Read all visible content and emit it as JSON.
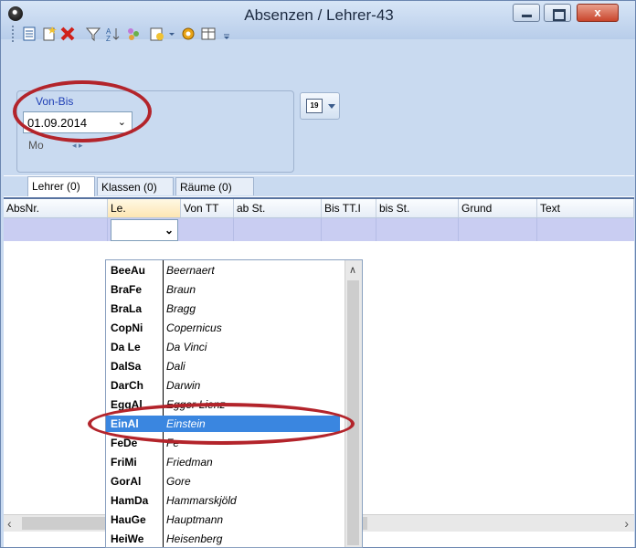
{
  "window": {
    "title": "Absenzen / Lehrer-43",
    "close_label": "x"
  },
  "toolbar": {
    "icons": [
      "list-icon",
      "new-icon",
      "delete-icon",
      "filter-icon",
      "sort-icon",
      "people-icon",
      "report-icon",
      "settings-icon",
      "calendar-grid-icon"
    ]
  },
  "range": {
    "group_label": "Von-Bis",
    "date_value": "01.09.2014",
    "weekday": "Mo",
    "nav": "◂ ▸"
  },
  "tabs": [
    {
      "label": "Lehrer (0)"
    },
    {
      "label": "Klassen (0)"
    },
    {
      "label": "Räume (0)"
    }
  ],
  "grid": {
    "columns": [
      "AbsNr.",
      "Le.",
      "Von TT",
      "ab St.",
      "Bis TT.I",
      "bis St.",
      "Grund",
      "Text"
    ]
  },
  "dropdown": {
    "items": [
      {
        "code": "BeeAu",
        "name": "Beernaert"
      },
      {
        "code": "BraFe",
        "name": "Braun"
      },
      {
        "code": "BraLa",
        "name": "Bragg"
      },
      {
        "code": "CopNi",
        "name": "Copernicus"
      },
      {
        "code": "Da Le",
        "name": "Da Vinci"
      },
      {
        "code": "DalSa",
        "name": "Dali"
      },
      {
        "code": "DarCh",
        "name": "Darwin"
      },
      {
        "code": "EggAl",
        "name": "Egger-Lienz"
      },
      {
        "code": "EinAl",
        "name": "Einstein"
      },
      {
        "code": "FeDe",
        "name": "Fe"
      },
      {
        "code": "FriMi",
        "name": "Friedman"
      },
      {
        "code": "GorAl",
        "name": "Gore"
      },
      {
        "code": "HamDa",
        "name": "Hammarskjöld"
      },
      {
        "code": "HauGe",
        "name": "Hauptmann"
      },
      {
        "code": "HeiWe",
        "name": "Heisenberg"
      }
    ],
    "selected": "EinAl"
  },
  "colors": {
    "highlight": "#3a86e0",
    "annotation": "#b3242b",
    "window_bg": "#c9daf0"
  }
}
